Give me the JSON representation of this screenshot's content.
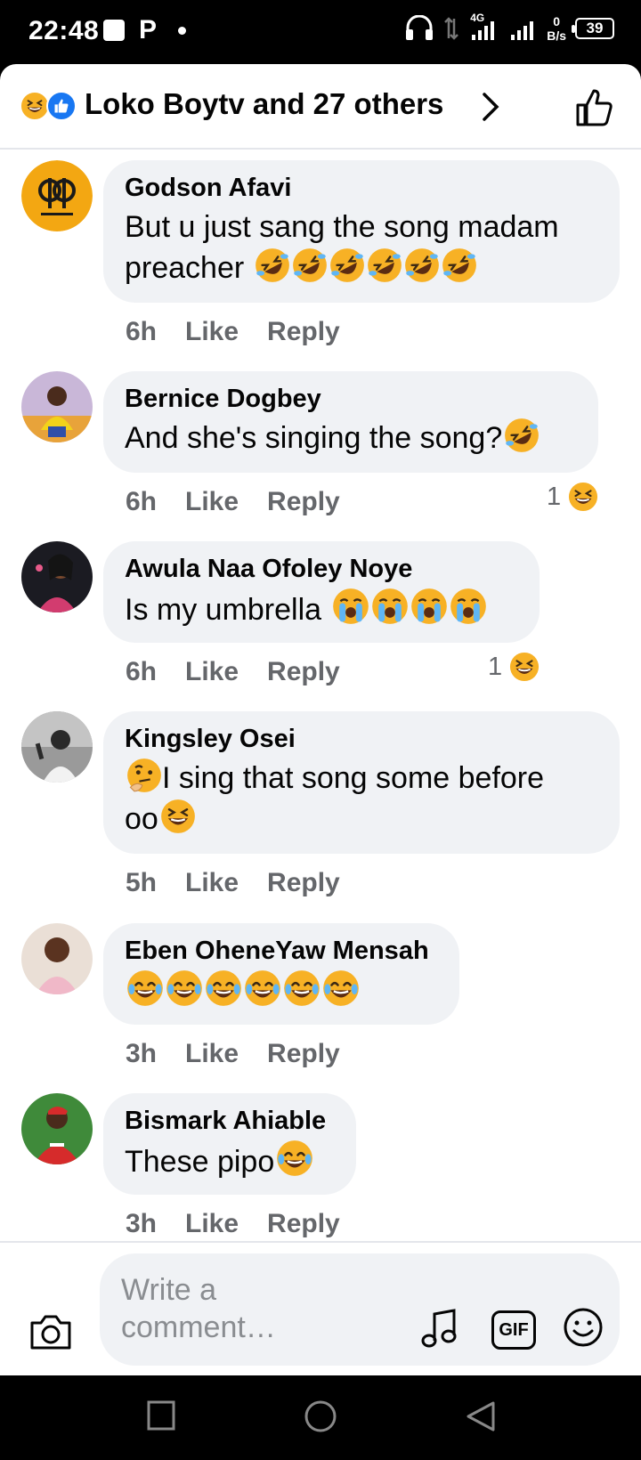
{
  "status_bar": {
    "time": "22:48",
    "network": "4G",
    "speed_value": "0",
    "speed_unit": "B/s",
    "battery": "39"
  },
  "reactions_header": {
    "title": "Loko Boytv and 27 others",
    "reaction_types": [
      "laugh-emoji",
      "like-thumb"
    ]
  },
  "comments": [
    {
      "name": "Godson Afavi",
      "text": "But u just sang the song madam preacher",
      "emojis": [
        "rofl",
        "rofl",
        "rofl",
        "rofl",
        "rofl",
        "rofl"
      ],
      "time": "6h",
      "like": "Like",
      "reply": "Reply",
      "reaction_count": ""
    },
    {
      "name": "Bernice Dogbey",
      "text": "And she's singing the song?",
      "emojis": [
        "rofl"
      ],
      "time": "6h",
      "like": "Like",
      "reply": "Reply",
      "reaction_count": "1"
    },
    {
      "name": "Awula Naa Ofoley Noye",
      "text": "Is my umbrella ",
      "emojis": [
        "crying",
        "crying",
        "crying",
        "crying"
      ],
      "time": "6h",
      "like": "Like",
      "reply": "Reply",
      "reaction_count": "1"
    },
    {
      "name": "Kingsley Osei",
      "text_line1": "I sing that song some before",
      "text_line2": "oo",
      "emojis": [
        "thinking",
        "squint-laugh"
      ],
      "time": "5h",
      "like": "Like",
      "reply": "Reply",
      "reaction_count": ""
    },
    {
      "name": "Eben OheneYaw Mensah",
      "text": "",
      "emojis": [
        "tears-of-joy",
        "tears-of-joy",
        "tears-of-joy",
        "tears-of-joy",
        "tears-of-joy",
        "tears-of-joy"
      ],
      "time": "3h",
      "like": "Like",
      "reply": "Reply",
      "reaction_count": ""
    },
    {
      "name": "Bismark Ahiable",
      "text": "These pipo",
      "emojis": [
        "tears-of-joy"
      ],
      "time": "3h",
      "like": "Like",
      "reply": "Reply",
      "reaction_count": ""
    }
  ],
  "composer": {
    "placeholder": "Write a comment…",
    "gif_label": "GIF"
  },
  "colors": {
    "background": "#ffffff",
    "bubble": "#f0f2f5",
    "secondary_text": "#65676b",
    "like_blue": "#1877f2",
    "emoji_yellow": "#f7b125"
  }
}
